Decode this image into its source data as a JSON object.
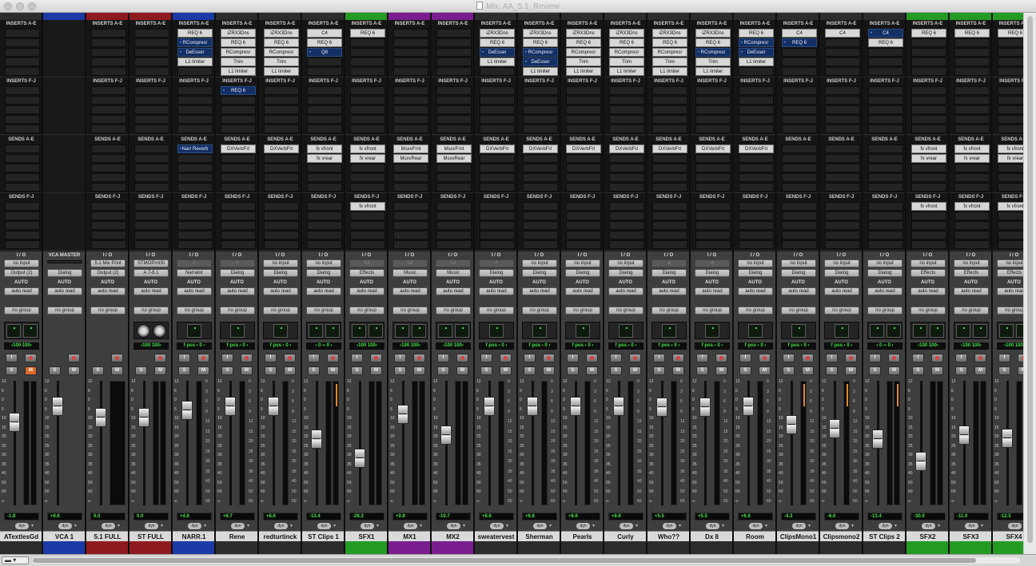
{
  "window": {
    "title": "Mix: AA_5.1_Review"
  },
  "labels": {
    "inserts_ae": "INSERTS A-E",
    "inserts_fj": "INSERTS F-J",
    "sends_ae": "SENDS A-E",
    "sends_fj": "SENDS F-J",
    "io": "I / O",
    "vca_master": "VCA MASTER",
    "auto": "AUTO",
    "dyn": "dyn"
  },
  "colors": {
    "red": "#8e1a20",
    "blue": "#1c3aa6",
    "green": "#239b23",
    "purple": "#7a1e8f",
    "none": "#2c2c2c",
    "send_bar_green": "#1e9a3a"
  },
  "fader_scale": [
    "12",
    "6",
    "0",
    "5",
    "10",
    "15",
    "20",
    "25",
    "30",
    "35",
    "40",
    "50",
    "60",
    "∞"
  ],
  "meter_scale": [
    "0",
    "3",
    "6",
    "9",
    "12",
    "15",
    "20",
    "25",
    "30",
    "35",
    "40",
    "50",
    "60"
  ],
  "tracks": [
    {
      "name": "ATextlesGd",
      "color": "none",
      "type": "audio",
      "inserts_ae": [],
      "inserts_fj": [],
      "sends_ae": [],
      "sends_fj": [],
      "input": "no input",
      "output": "Output (2)",
      "auto": "auto read",
      "group": "no group",
      "pan_mode": "stereo",
      "pan_read": "‹100   100›",
      "mute_active": true,
      "volume": "-1.8",
      "fader_pos": 0.3
    },
    {
      "name": "VCA 1",
      "color": "blue",
      "type": "vca",
      "inserts_ae": [],
      "inserts_fj": [],
      "sends_ae": [],
      "sends_fj": [],
      "input": "VCA MASTER",
      "output": "Dialog",
      "auto": "auto read",
      "group": "no group",
      "pan_mode": "none",
      "pan_read": "",
      "mute_active": false,
      "volume": "+6.6",
      "fader_pos": 0.14
    },
    {
      "name": "5.1 FULL",
      "color": "red",
      "type": "aux",
      "inserts_ae": [],
      "inserts_fj": [],
      "sends_ae": [],
      "sends_fj": [],
      "input": "5.1 Mix Print",
      "output": "Output (2)",
      "auto": "auto read",
      "group": "no group",
      "pan_mode": "none",
      "pan_read": "",
      "mute_active": false,
      "volume": "0.0",
      "fader_pos": 0.25
    },
    {
      "name": "ST FULL",
      "color": "red",
      "type": "aux",
      "inserts_ae": [],
      "inserts_fj": [],
      "sends_ae": [],
      "sends_fj": [],
      "input": "STMOPrntSt",
      "output": "A 7-8.1",
      "auto": "auto read",
      "group": "no group",
      "pan_mode": "knobs",
      "pan_read": "‹100   100›",
      "mute_active": false,
      "volume": "0.0",
      "fader_pos": 0.25
    },
    {
      "name": "NARR.1",
      "color": "blue",
      "type": "audio",
      "inserts_ae": [
        "REQ 6",
        "RCompresr",
        "DeEsser",
        "L1 limiter"
      ],
      "inserts_fj": [],
      "sends_ae": [
        "Narr Reverb"
      ],
      "sends_fj": [],
      "input": "f",
      "output": "Narrator",
      "auto": "auto read",
      "group": "no group",
      "pan_mode": "mono",
      "pan_read": "f pos  ‹  0  ›",
      "mute_active": false,
      "volume": "+4.6",
      "fader_pos": 0.18
    },
    {
      "name": "Rene",
      "color": "none",
      "type": "audio",
      "inserts_ae": [
        "iZRX3Dns",
        "REQ 6",
        "RCompresr",
        "Trim",
        "L1 limiter"
      ],
      "inserts_fj": [
        "REQ 6"
      ],
      "sends_ae": [
        "DXVerbFrt"
      ],
      "sends_fj": [],
      "input": "f",
      "output": "Dialog",
      "auto": "auto read",
      "group": "no group",
      "pan_mode": "mono",
      "pan_read": "f pos  ‹  0  ›",
      "mute_active": false,
      "volume": "+6.7",
      "fader_pos": 0.14
    },
    {
      "name": "redturtinck",
      "color": "none",
      "type": "audio",
      "inserts_ae": [
        "iZRX3Dns",
        "REQ 6",
        "RCompresr",
        "Trim",
        "L1 limiter"
      ],
      "inserts_fj": [],
      "sends_ae": [
        "DXVerbFrt"
      ],
      "sends_fj": [],
      "input": "no input",
      "output": "Dialog",
      "auto": "auto read",
      "group": "no group",
      "pan_mode": "mono",
      "pan_read": "f pos  ‹  0  ›",
      "mute_active": false,
      "volume": "+6.6",
      "fader_pos": 0.14
    },
    {
      "name": "ST Clips 1",
      "color": "none",
      "type": "audio",
      "inserts_ae": [
        "C4",
        "REQ 6",
        "Q8"
      ],
      "inserts_fj": [],
      "sends_ae": [
        "fx vfront",
        "fx vrear"
      ],
      "sends_fj": [],
      "input": "no input",
      "output": "Dialog",
      "auto": "auto read",
      "group": "no group",
      "pan_mode": "stereo",
      "pan_read": "‹  0  ›‹  0  ›",
      "mute_active": false,
      "volume": "-13.4",
      "fader_pos": 0.46
    },
    {
      "name": "SFX1",
      "color": "green",
      "type": "audio",
      "inserts_ae": [
        "REQ 6"
      ],
      "inserts_fj": [],
      "sends_ae": [
        "fx vfront",
        "fx vrear"
      ],
      "sends_fj": [
        "fx vfront"
      ],
      "input": "f-2",
      "output": "Effects",
      "auto": "auto read",
      "group": "no group",
      "pan_mode": "stereo",
      "pan_read": "‹100   100›",
      "mute_active": false,
      "volume": "-28.3",
      "fader_pos": 0.65
    },
    {
      "name": "MX1",
      "color": "purple",
      "type": "audio",
      "inserts_ae": [],
      "inserts_fj": [],
      "sends_ae": [
        "MsxvFrnt",
        "MsxvRear"
      ],
      "sends_fj": [],
      "input": "f-2",
      "output": "Music",
      "auto": "auto read",
      "group": "no group",
      "pan_mode": "stereo",
      "pan_read": "‹100   100›",
      "mute_active": false,
      "volume": "+0.8",
      "fader_pos": 0.22
    },
    {
      "name": "MX2",
      "color": "purple",
      "type": "audio",
      "inserts_ae": [],
      "inserts_fj": [],
      "sends_ae": [
        "MsxvFrnt",
        "MsxvRear"
      ],
      "sends_fj": [],
      "input": "f-2",
      "output": "Music",
      "auto": "auto read",
      "group": "no group",
      "pan_mode": "stereo",
      "pan_read": "‹100   100›",
      "mute_active": false,
      "volume": "-10.7",
      "fader_pos": 0.42
    },
    {
      "name": "sweatervest",
      "color": "none",
      "type": "audio",
      "inserts_ae": [
        "iZRX3Dns",
        "REQ 6",
        "DeEsser",
        "L1 limiter"
      ],
      "inserts_fj": [],
      "sends_ae": [
        "DXVerbFrt"
      ],
      "sends_fj": [],
      "input": "f",
      "output": "Dialog",
      "auto": "auto read",
      "group": "no group",
      "pan_mode": "mono",
      "pan_read": "f pos  ‹  0  ›",
      "mute_active": false,
      "volume": "+6.6",
      "fader_pos": 0.14
    },
    {
      "name": "Sherman",
      "color": "none",
      "type": "audio",
      "inserts_ae": [
        "iZRX3Dns",
        "REQ 6",
        "RCompresr",
        "DeEsser",
        "L1 limiter"
      ],
      "inserts_fj": [],
      "sends_ae": [
        "DXVerbFrt"
      ],
      "sends_fj": [],
      "input": "no input",
      "output": "Dialog",
      "auto": "auto read",
      "group": "no group",
      "pan_mode": "mono",
      "pan_read": "f pos  ‹  0  ›",
      "mute_active": false,
      "volume": "+6.6",
      "fader_pos": 0.14
    },
    {
      "name": "Pearls",
      "color": "none",
      "type": "audio",
      "inserts_ae": [
        "iZRX3Dns",
        "REQ 6",
        "RCompresr",
        "Trim",
        "L1 limiter"
      ],
      "inserts_fj": [],
      "sends_ae": [
        "DXVerbFrt"
      ],
      "sends_fj": [],
      "input": "no input",
      "output": "Dialog",
      "auto": "auto read",
      "group": "no group",
      "pan_mode": "mono",
      "pan_read": "f pos  ‹  0  ›",
      "mute_active": false,
      "volume": "+6.6",
      "fader_pos": 0.14
    },
    {
      "name": "Curly",
      "color": "none",
      "type": "audio",
      "inserts_ae": [
        "iZRX3Dns",
        "REQ 6",
        "RCompresr",
        "Trim",
        "L1 limiter"
      ],
      "inserts_fj": [],
      "sends_ae": [
        "DXVerbFrt"
      ],
      "sends_fj": [],
      "input": "no input",
      "output": "Dialog",
      "auto": "auto read",
      "group": "no group",
      "pan_mode": "mono",
      "pan_read": "f pos  ‹  0  ›",
      "mute_active": false,
      "volume": "+6.6",
      "fader_pos": 0.14
    },
    {
      "name": "Who??",
      "color": "none",
      "type": "audio",
      "inserts_ae": [
        "iZRX3Dns",
        "REQ 6",
        "RCompresr",
        "Trim",
        "L1 limiter"
      ],
      "inserts_fj": [],
      "sends_ae": [
        "DXVerbFrt"
      ],
      "sends_fj": [],
      "input": "d",
      "output": "Dialog",
      "auto": "auto read",
      "group": "no group",
      "pan_mode": "mono",
      "pan_read": "f pos  ‹  0  ›",
      "mute_active": false,
      "volume": "+5.5",
      "fader_pos": 0.15
    },
    {
      "name": "Dx 8",
      "color": "none",
      "type": "audio",
      "inserts_ae": [
        "iZRX3Dns",
        "REQ 6",
        "RCompresr",
        "Trim",
        "L1 limiter"
      ],
      "inserts_fj": [],
      "sends_ae": [
        "DXVerbFrt"
      ],
      "sends_fj": [],
      "input": "d",
      "output": "Dialog",
      "auto": "auto read",
      "group": "no group",
      "pan_mode": "mono",
      "pan_read": "f pos  ‹  0  ›",
      "mute_active": false,
      "volume": "+5.5",
      "fader_pos": 0.15
    },
    {
      "name": "Room",
      "color": "none",
      "type": "audio",
      "inserts_ae": [
        "REQ 6",
        "RCompresr",
        "DeEsser",
        "L1 limiter"
      ],
      "inserts_fj": [],
      "sends_ae": [
        "DXVerbFrt"
      ],
      "sends_fj": [],
      "input": "no input",
      "output": "Dialog",
      "auto": "auto read",
      "group": "no group",
      "pan_mode": "mono",
      "pan_read": "f pos  ‹  0  ›",
      "mute_active": false,
      "volume": "+6.6",
      "fader_pos": 0.14
    },
    {
      "name": "ClipsMono1",
      "color": "none",
      "type": "audio",
      "inserts_ae": [
        "C4",
        "REQ 6"
      ],
      "inserts_fj": [],
      "sends_ae": [],
      "sends_fj": [],
      "input": "no input",
      "output": "Dialog",
      "auto": "auto read",
      "group": "no group",
      "pan_mode": "mono",
      "pan_read": "f pos  ‹  0  ›",
      "mute_active": false,
      "volume": "-4.3",
      "fader_pos": 0.32
    },
    {
      "name": "Clipsmono2",
      "color": "none",
      "type": "audio",
      "inserts_ae": [
        "C4"
      ],
      "inserts_fj": [],
      "sends_ae": [],
      "sends_fj": [],
      "input": "no input",
      "output": "Dialog",
      "auto": "auto read",
      "group": "no group",
      "pan_mode": "mono",
      "pan_read": "f pos  ‹  0  ›",
      "mute_active": false,
      "volume": "-6.0",
      "fader_pos": 0.36
    },
    {
      "name": "ST Clips 2",
      "color": "none",
      "type": "audio",
      "inserts_ae": [
        "C4",
        "REQ 6"
      ],
      "inserts_fj": [],
      "sends_ae": [],
      "sends_fj": [],
      "input": "no input",
      "output": "Dialog",
      "auto": "auto read",
      "group": "no group",
      "pan_mode": "stereo",
      "pan_read": "‹  0  ›‹  0  ›",
      "mute_active": false,
      "volume": "-13.4",
      "fader_pos": 0.46
    },
    {
      "name": "SFX2",
      "color": "green",
      "type": "audio",
      "inserts_ae": [
        "REQ 6"
      ],
      "inserts_fj": [],
      "sends_ae": [
        "fx vfront",
        "fx vrear"
      ],
      "sends_fj": [
        "fx vfront"
      ],
      "input": "no input",
      "output": "Effects",
      "auto": "auto read",
      "group": "no group",
      "pan_mode": "stereo",
      "pan_read": "‹100   100›",
      "mute_active": false,
      "volume": "-30.0",
      "fader_pos": 0.68
    },
    {
      "name": "SFX3",
      "color": "green",
      "type": "audio",
      "inserts_ae": [
        "REQ 6"
      ],
      "inserts_fj": [],
      "sends_ae": [
        "fx vfront",
        "fx vrear"
      ],
      "sends_fj": [
        "fx vfront"
      ],
      "input": "no input",
      "output": "Effects",
      "auto": "auto read",
      "group": "no group",
      "pan_mode": "stereo",
      "pan_read": "‹100   100›",
      "mute_active": false,
      "volume": "-11.0",
      "fader_pos": 0.42
    },
    {
      "name": "SFX4",
      "color": "green",
      "type": "audio",
      "inserts_ae": [
        "REQ 6"
      ],
      "inserts_fj": [],
      "sends_ae": [
        "fx vfront",
        "fx vrear"
      ],
      "sends_fj": [
        "fx vfront"
      ],
      "input": "no input",
      "output": "Effects",
      "auto": "auto read",
      "group": "no group",
      "pan_mode": "stereo",
      "pan_read": "‹100   100›",
      "mute_active": false,
      "volume": "-12.5",
      "fader_pos": 0.45
    }
  ]
}
